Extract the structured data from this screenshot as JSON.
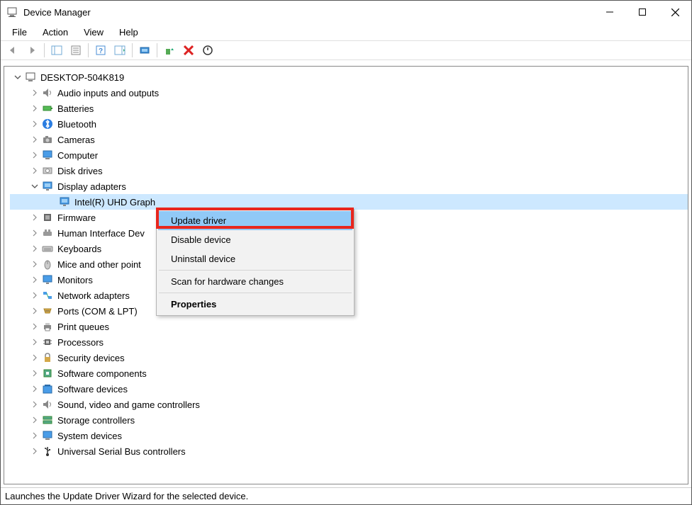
{
  "window": {
    "title": "Device Manager"
  },
  "menubar": [
    "File",
    "Action",
    "View",
    "Help"
  ],
  "root_node": "DESKTOP-504K819",
  "categories": [
    "Audio inputs and outputs",
    "Batteries",
    "Bluetooth",
    "Cameras",
    "Computer",
    "Disk drives",
    "Display adapters",
    "Firmware",
    "Human Interface Dev",
    "Keyboards",
    "Mice and other point",
    "Monitors",
    "Network adapters",
    "Ports (COM & LPT)",
    "Print queues",
    "Processors",
    "Security devices",
    "Software components",
    "Software devices",
    "Sound, video and game controllers",
    "Storage controllers",
    "System devices",
    "Universal Serial Bus controllers"
  ],
  "expanded_device": "Intel(R) UHD Graph",
  "context_menu": {
    "update": "Update driver",
    "disable": "Disable device",
    "uninstall": "Uninstall device",
    "scan": "Scan for hardware changes",
    "properties": "Properties"
  },
  "statusbar": "Launches the Update Driver Wizard for the selected device."
}
